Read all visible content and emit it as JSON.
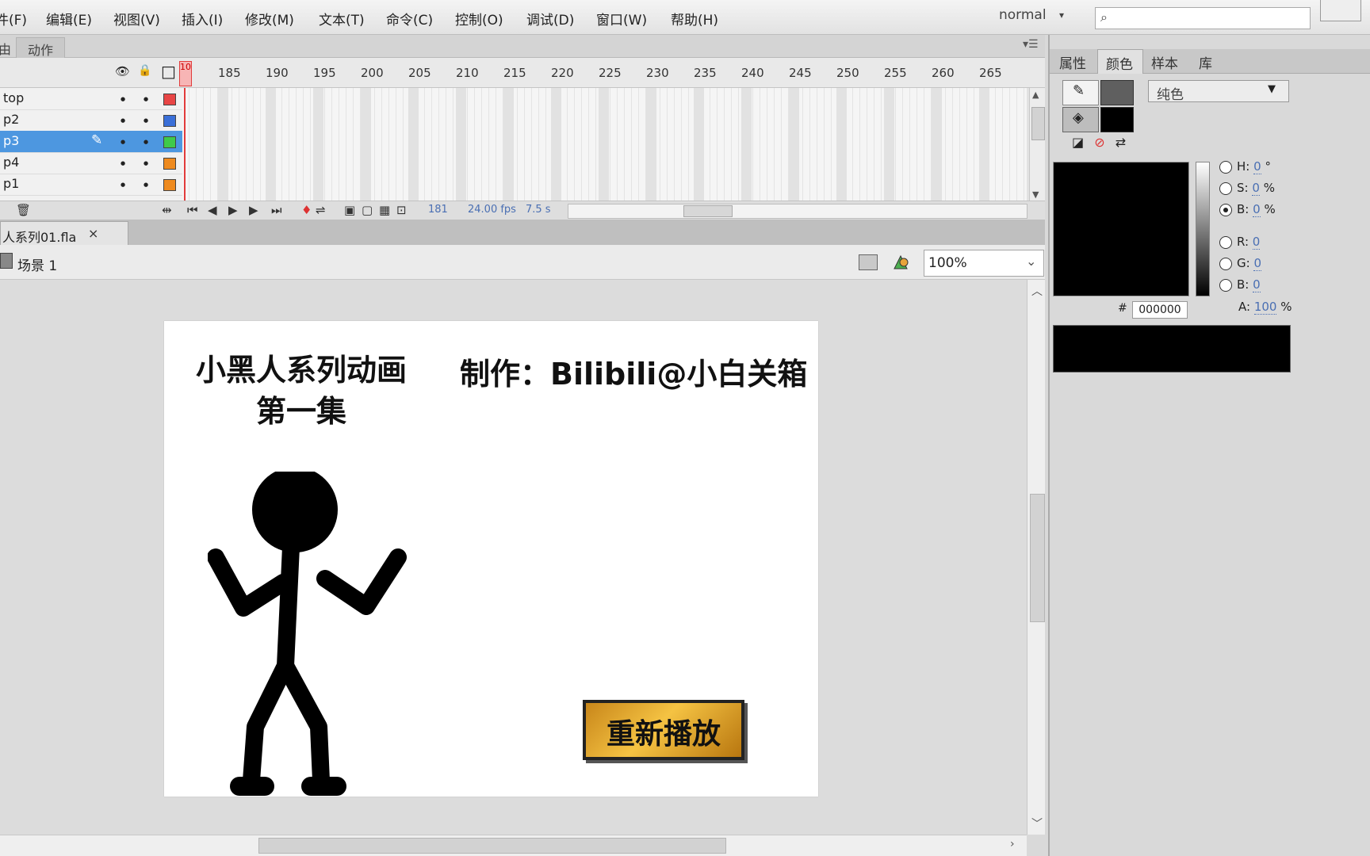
{
  "menu": {
    "items": [
      "件(F)",
      "编辑(E)",
      "视图(V)",
      "插入(I)",
      "修改(M)",
      "文本(T)",
      "命令(C)",
      "控制(O)",
      "调试(D)",
      "窗口(W)",
      "帮助(H)"
    ],
    "workspace": "normal",
    "search_icon": "⌕"
  },
  "timeline": {
    "tabs": [
      "由",
      "动作"
    ],
    "menu_icon": "▾☰",
    "playhead_label": "10",
    "frame_numbers": [
      "185",
      "190",
      "195",
      "200",
      "205",
      "210",
      "215",
      "220",
      "225",
      "230",
      "235",
      "240",
      "245",
      "250",
      "255",
      "260",
      "265"
    ],
    "layers": [
      {
        "name": "top",
        "color": "#e84545",
        "selected": false
      },
      {
        "name": "p2",
        "color": "#3a6fd8",
        "selected": false
      },
      {
        "name": "p3",
        "color": "#3fca4a",
        "selected": true
      },
      {
        "name": "p4",
        "color": "#ee8a1e",
        "selected": false
      },
      {
        "name": "p1",
        "color": "#ee8a1e",
        "selected": false
      }
    ],
    "header_icons": {
      "eye": "👁",
      "lock": "🔒",
      "outline": "□"
    },
    "footer": {
      "current_frame": "181",
      "fps": "24.00 fps",
      "time": "7.5 s"
    }
  },
  "document": {
    "tab_label": "人系列01.fla",
    "close": "×",
    "scene_label": "场景 1",
    "zoom": "100%"
  },
  "stage": {
    "title_left_line1": "小黑人系列动画",
    "title_left_line2": "第一集",
    "title_right": "制作：Bilibili@小白关箱",
    "replay_button": "重新播放"
  },
  "right_panel": {
    "tabs": [
      "属性",
      "颜色",
      "样本",
      "库"
    ],
    "fill_type": "纯色",
    "hsb": [
      {
        "label": "H:",
        "value": "0",
        "unit": "°",
        "selected": false
      },
      {
        "label": "S:",
        "value": "0",
        "unit": "%",
        "selected": false
      },
      {
        "label": "B:",
        "value": "0",
        "unit": "%",
        "selected": true
      }
    ],
    "rgb": [
      {
        "label": "R:",
        "value": "0"
      },
      {
        "label": "G:",
        "value": "0"
      },
      {
        "label": "B:",
        "value": "0"
      }
    ],
    "hex_label": "#",
    "hex": "000000",
    "alpha_label": "A:",
    "alpha_value": "100",
    "alpha_unit": "%",
    "stroke_color": "#5f5f5f",
    "fill_color": "#000000"
  }
}
